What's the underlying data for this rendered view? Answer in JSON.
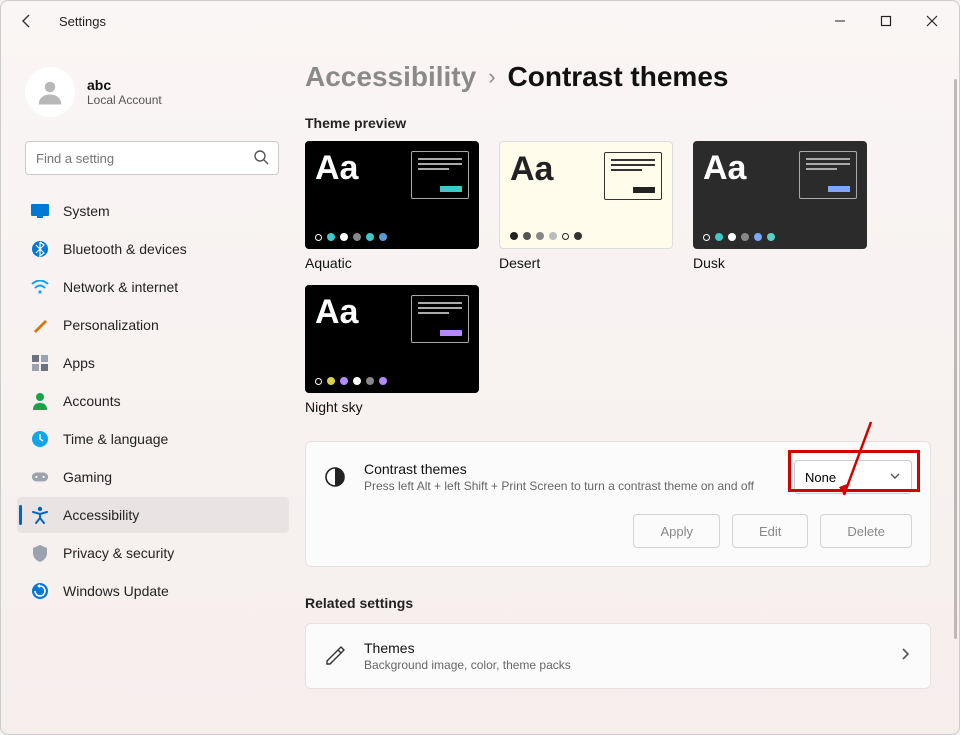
{
  "app_title": "Settings",
  "user": {
    "name": "abc",
    "sub": "Local Account"
  },
  "search": {
    "placeholder": "Find a setting"
  },
  "nav": {
    "system": "System",
    "bluetooth": "Bluetooth & devices",
    "network": "Network & internet",
    "personalization": "Personalization",
    "apps": "Apps",
    "accounts": "Accounts",
    "time": "Time & language",
    "gaming": "Gaming",
    "accessibility": "Accessibility",
    "privacy": "Privacy & security",
    "update": "Windows Update"
  },
  "breadcrumb": {
    "parent": "Accessibility",
    "current": "Contrast themes"
  },
  "preview_label": "Theme preview",
  "themes": {
    "aquatic": "Aquatic",
    "desert": "Desert",
    "dusk": "Dusk",
    "nightsky": "Night sky"
  },
  "contrast_card": {
    "title": "Contrast themes",
    "desc": "Press left Alt + left Shift + Print Screen to turn a contrast theme on and off",
    "selected": "None"
  },
  "buttons": {
    "apply": "Apply",
    "edit": "Edit",
    "delete": "Delete"
  },
  "related": {
    "label": "Related settings",
    "themes_title": "Themes",
    "themes_desc": "Background image, color, theme packs"
  },
  "colors": {
    "aquatic_bg": "#000000",
    "aquatic_fg": "#ffffff",
    "aquatic_accent": "#3cc9c7",
    "desert_bg": "#fffceb",
    "desert_fg": "#222222",
    "desert_accent": "#222222",
    "dusk_bg": "#2b2b2b",
    "dusk_fg": "#ffffff",
    "dusk_accent": "#7aa7ff",
    "night_bg": "#000000",
    "night_fg": "#ffffff",
    "night_accent": "#b58aff"
  }
}
